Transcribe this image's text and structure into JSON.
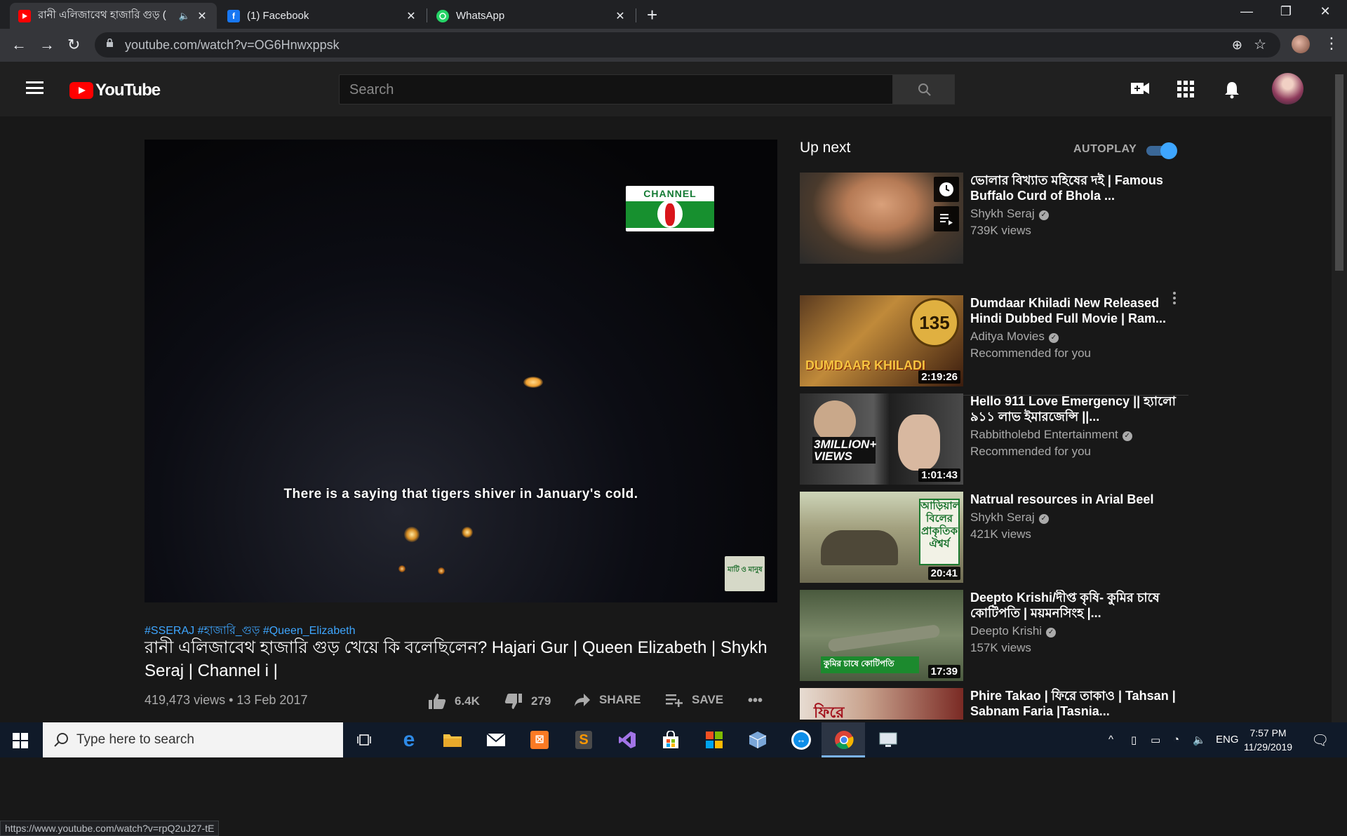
{
  "browser": {
    "tabs": [
      {
        "title": "রানী এলিজাবেথ হাজারি গুড় (",
        "close": "✕"
      },
      {
        "title": "(1) Facebook",
        "close": "✕"
      },
      {
        "title": "WhatsApp",
        "close": "✕"
      }
    ],
    "new_tab": "+",
    "url": "youtube.com/watch?v=OG6Hnwxppsk",
    "window_controls": [
      "—",
      "❐",
      "✕"
    ]
  },
  "youtube": {
    "logo_text": "YouTube",
    "search_placeholder": "Search"
  },
  "video": {
    "subtitle": "There is a saying that tigers shiver in January's cold.",
    "channel_logo_text": "CHANNEL",
    "watermark_text": "মাটি ও মানুষ",
    "tags": "#SSERAJ #হাজারি_গুড় #Queen_Elizabeth",
    "title": "রানী এলিজাবেথ হাজারি গুড় খেয়ে কি বলেছিলেন? Hajari Gur | Queen Elizabeth | Shykh Seraj | Channel i |",
    "views_date": "419,473 views • 13 Feb 2017",
    "likes": "6.4K",
    "dislikes": "279",
    "share_label": "SHARE",
    "save_label": "SAVE",
    "more_label": "•••"
  },
  "status_url": "https://www.youtube.com/watch?v=rpQ2uJ27-tE",
  "sidebar": {
    "up_next": "Up next",
    "autoplay": "AUTOPLAY",
    "autoplay_on": true,
    "recommendations": [
      {
        "title": "ভোলার বিখ্যাত মহিষের দই | Famous Buffalo Curd of Bhola ...",
        "channel": "Shykh Seraj",
        "meta": "739K views",
        "duration": ""
      },
      {
        "title": "Dumdaar Khiladi New Released Hindi Dubbed Full Movie | Ram...",
        "channel": "Aditya Movies",
        "meta": "Recommended for you",
        "duration": "2:19:26",
        "thumb_text": "DUMDAAR KHILADI",
        "badge": "135"
      },
      {
        "title": "Hello 911 Love Emergency || হ্যালো ৯১১ লাভ ইমারজেন্সি ||...",
        "channel": "Rabbitholebd Entertainment",
        "meta": "Recommended for you",
        "duration": "1:01:43",
        "thumb_text": "3MILLION+ VIEWS"
      },
      {
        "title": "Natrual resources in Arial Beel",
        "channel": "Shykh Seraj",
        "meta": "421K views",
        "duration": "20:41",
        "thumb_text": "আড়িয়াল বিলের প্রাকৃতিক ঐশ্বর্য"
      },
      {
        "title": "Deepto Krishi/দীপ্ত কৃষি- কুমির চাষে কোটিপতি | ময়মনসিংহ |...",
        "channel": "Deepto Krishi",
        "meta": "157K views",
        "duration": "17:39",
        "thumb_text": "কুমির চাষে কোটিপতি"
      },
      {
        "title": "Phire Takao | ফিরে তাকাও | Tahsan | Sabnam Faria |Tasnia...",
        "channel": "",
        "meta": "",
        "duration": "",
        "thumb_text": "ফিরে"
      }
    ]
  },
  "taskbar": {
    "search_placeholder": "Type here to search",
    "language": "ENG",
    "time": "7:57 PM",
    "date": "11/29/2019"
  }
}
